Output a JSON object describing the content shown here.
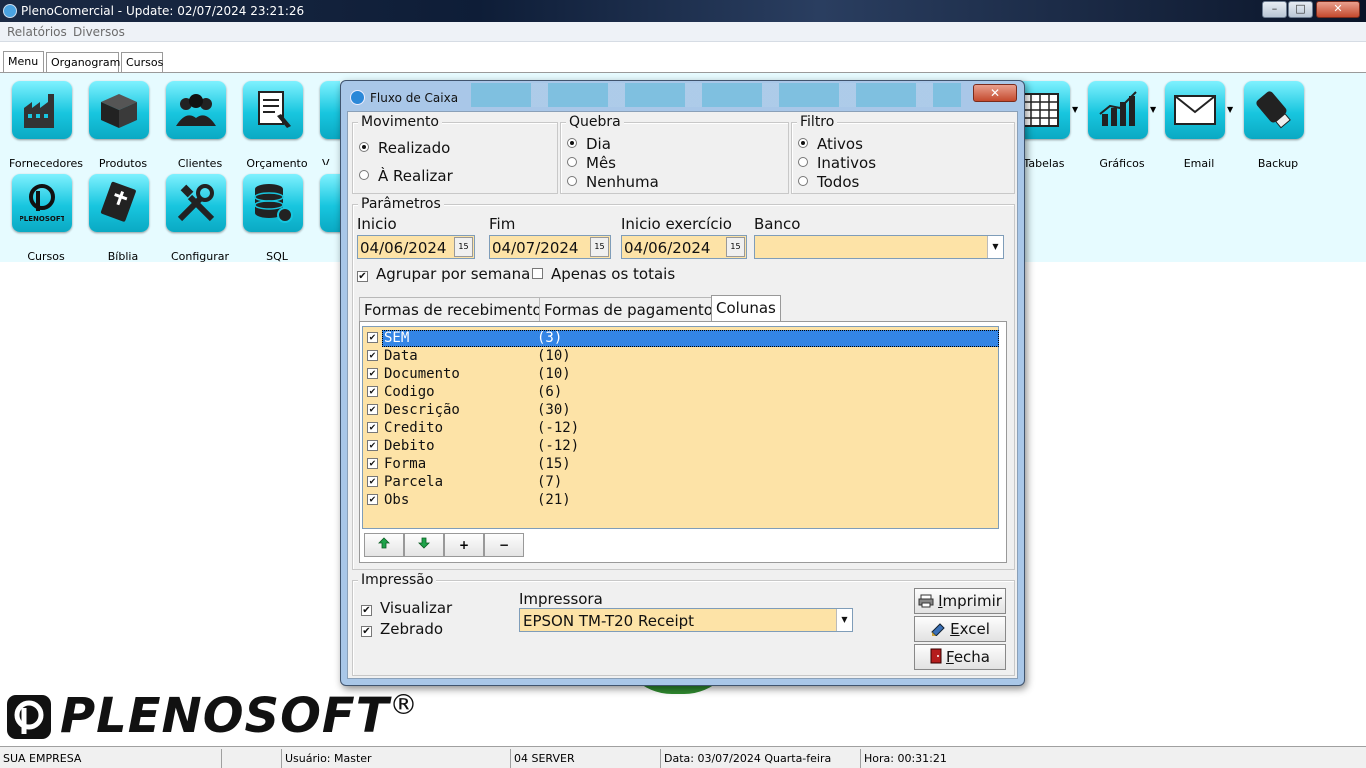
{
  "window": {
    "title": "PlenoComercial - Update: 02/07/2024 23:21:26",
    "controls": {
      "minimize": "–",
      "maximize": "□",
      "close": "✕"
    }
  },
  "menubar": [
    "Relatórios",
    "Diversos"
  ],
  "main_tabs": [
    "Menu",
    "Organograma",
    "Cursos"
  ],
  "tiles_row1": [
    {
      "label": "Fornecedores",
      "icon": "factory-icon"
    },
    {
      "label": "Produtos",
      "icon": "box-icon"
    },
    {
      "label": "Clientes",
      "icon": "people-icon"
    },
    {
      "label": "Orçamento",
      "icon": "document-edit-icon"
    },
    {
      "label": "V",
      "icon": "generic-icon"
    }
  ],
  "tiles_row1_right": [
    {
      "label": "Tabelas",
      "icon": "table-icon"
    },
    {
      "label": "Gráficos",
      "icon": "chart-icon"
    },
    {
      "label": "Email",
      "icon": "envelope-icon"
    },
    {
      "label": "Backup",
      "icon": "usb-drive-icon"
    }
  ],
  "tiles_row2": [
    {
      "label": "Cursos",
      "icon": "plenosoft-logo-icon"
    },
    {
      "label": "Bíblia",
      "icon": "bible-icon"
    },
    {
      "label": "Configurar",
      "icon": "tools-icon"
    },
    {
      "label": "SQL",
      "icon": "database-gear-icon"
    }
  ],
  "logo": {
    "text": "PLENOSOFT",
    "registered": "®"
  },
  "statusbar": {
    "company": "SUA EMPRESA",
    "user": "Usuário: Master",
    "server": "04 SERVER",
    "date": "Data: 03/07/2024 Quarta-feira",
    "time": "Hora: 00:31:21"
  },
  "dialog": {
    "title": "Fluxo de Caixa",
    "close_label": "✕",
    "movimento": {
      "title": "Movimento",
      "options": [
        "Realizado",
        "À Realizar"
      ],
      "selected": 0
    },
    "quebra": {
      "title": "Quebra",
      "options": [
        "Dia",
        "Mês",
        "Nenhuma"
      ],
      "selected": 0
    },
    "filtro": {
      "title": "Filtro",
      "options": [
        "Ativos",
        "Inativos",
        "Todos"
      ],
      "selected": 0
    },
    "parametros": {
      "title": "Parâmetros",
      "inicio_label": "Inicio",
      "inicio_value": "04/06/2024",
      "fim_label": "Fim",
      "fim_value": "04/07/2024",
      "inicio_exercicio_label": "Inicio exercício",
      "inicio_exercicio_value": "04/06/2024",
      "banco_label": "Banco",
      "banco_value": "",
      "calendar_glyph": "15",
      "agrupar_label": "Agrupar por semana",
      "agrupar_checked": true,
      "apenas_totais_label": "Apenas os totais",
      "apenas_totais_checked": false
    },
    "tabs": [
      "Formas de recebimento",
      "Formas de pagamento",
      "Colunas"
    ],
    "active_tab": 2,
    "columns": [
      {
        "name": "SEM",
        "size": "(3)",
        "checked": true,
        "selected": true
      },
      {
        "name": "Data",
        "size": "(10)",
        "checked": true
      },
      {
        "name": "Documento",
        "size": "(10)",
        "checked": true
      },
      {
        "name": "Codigo",
        "size": "(6)",
        "checked": true
      },
      {
        "name": "Descrição",
        "size": "(30)",
        "checked": true
      },
      {
        "name": "Credito",
        "size": "(-12)",
        "checked": true
      },
      {
        "name": "Debito",
        "size": "(-12)",
        "checked": true
      },
      {
        "name": "Forma",
        "size": "(15)",
        "checked": true
      },
      {
        "name": "Parcela",
        "size": "(7)",
        "checked": true
      },
      {
        "name": "Obs",
        "size": "(21)",
        "checked": true
      }
    ],
    "column_buttons": {
      "up": "🡅",
      "down": "🡇",
      "add": "+",
      "remove": "−"
    },
    "impressao": {
      "title": "Impressão",
      "visualizar_label": "Visualizar",
      "visualizar_checked": true,
      "zebrado_label": "Zebrado",
      "zebrado_checked": true,
      "impressora_label": "Impressora",
      "impressora_value": "EPSON TM-T20 Receipt"
    },
    "buttons": {
      "imprimir": {
        "first": "I",
        "rest": "mprimir"
      },
      "excel": {
        "first": "E",
        "rest": "xcel"
      },
      "fecha": {
        "first": "F",
        "rest": "echa"
      }
    }
  },
  "colors": {
    "icon_cyan": "#18c6df",
    "field_bg": "#fde3a7",
    "selection": "#3385e5",
    "panel_bg": "#e6fbff"
  }
}
